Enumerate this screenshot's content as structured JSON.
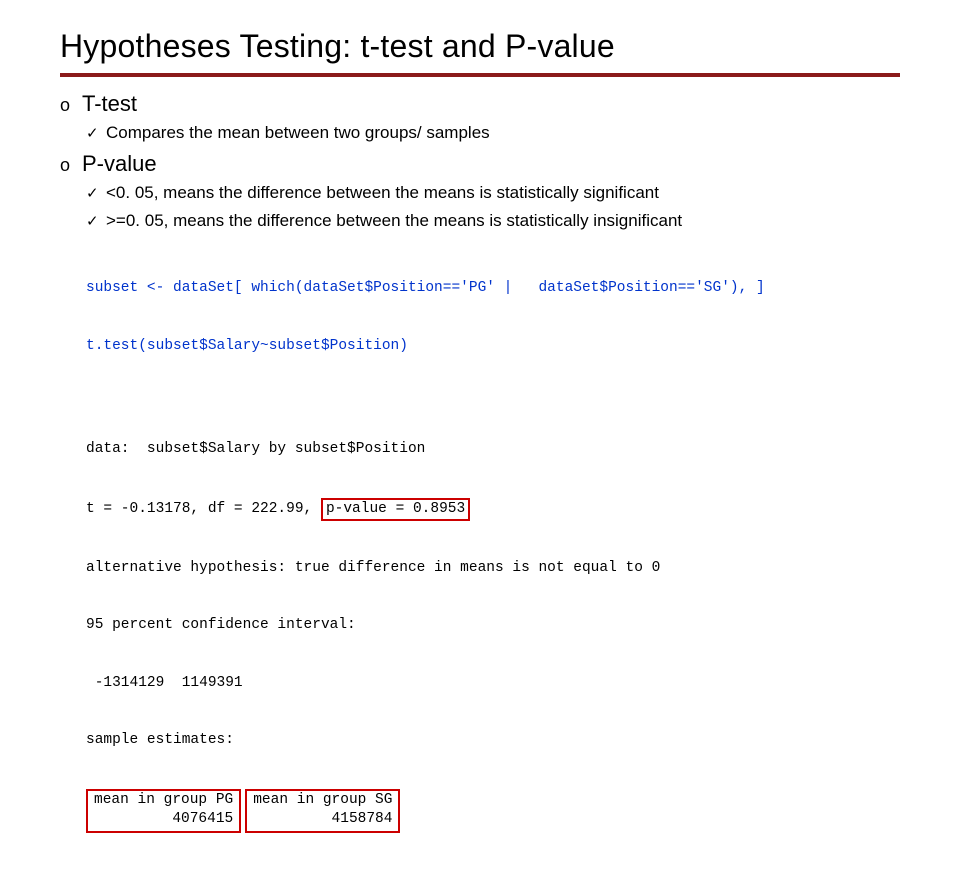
{
  "title": "Hypotheses Testing: t-test and P-value",
  "bullets": {
    "circle": "o",
    "check": "✓"
  },
  "sections": [
    {
      "heading": "T-test",
      "points": [
        "Compares the mean between two groups/ samples"
      ]
    },
    {
      "heading": "P-value",
      "points": [
        "<0. 05, means the difference between the means is statistically significant",
        ">=0. 05, means the difference between the means is statistically insignificant"
      ]
    }
  ],
  "code": {
    "input": [
      "subset <- dataSet[ which(dataSet$Position=='PG' |   dataSet$Position=='SG'), ]",
      "t.test(subset$Salary~subset$Position)"
    ],
    "output": {
      "data_line": "data:  subset$Salary by subset$Position",
      "stats_prefix": "t = -0.13178, df = 222.99, ",
      "pvalue_boxed": "p-value = 0.8953",
      "alt_hyp": "alternative hypothesis: true difference in means is not equal to 0",
      "ci_label": "95 percent confidence interval:",
      "ci_values": " -1314129  1149391",
      "sample_est_label": "sample estimates:",
      "mean_pg": {
        "label": "mean in group PG",
        "value": "4076415"
      },
      "mean_sg": {
        "label": "mean in group SG",
        "value": "4158784"
      }
    }
  }
}
